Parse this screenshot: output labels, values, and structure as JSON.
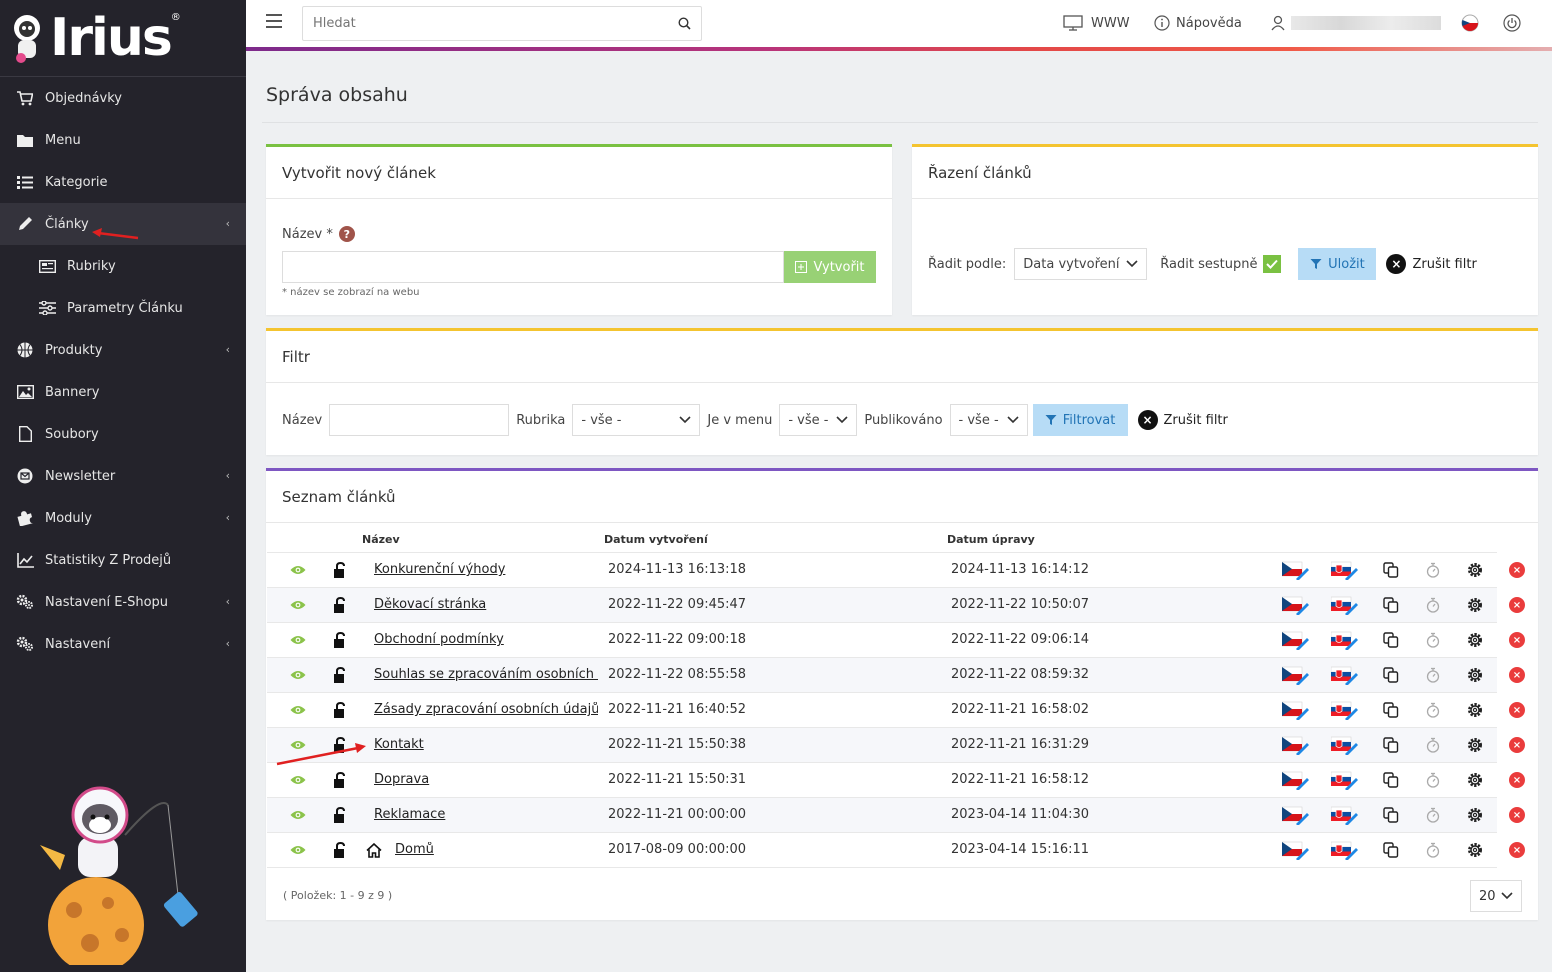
{
  "brand": {
    "logo_text": "Irius",
    "reg_mark": "®"
  },
  "sidebar": {
    "items": [
      {
        "label": "Objednávky",
        "icon": "cart-icon"
      },
      {
        "label": "Menu",
        "icon": "folder-icon"
      },
      {
        "label": "Kategorie",
        "icon": "list-icon"
      },
      {
        "label": "Články",
        "icon": "pencil-icon",
        "active": true
      },
      {
        "label": "Rubriky",
        "icon": "newspaper-icon",
        "sub": true
      },
      {
        "label": "Parametry Článku",
        "icon": "sliders-icon",
        "sub": true
      },
      {
        "label": "Produkty",
        "icon": "basketball-icon"
      },
      {
        "label": "Bannery",
        "icon": "image-icon"
      },
      {
        "label": "Soubory",
        "icon": "file-icon"
      },
      {
        "label": "Newsletter",
        "icon": "envelope-circle-icon"
      },
      {
        "label": "Moduly",
        "icon": "puzzle-icon"
      },
      {
        "label": "Statistiky Z Prodejů",
        "icon": "chart-line-icon"
      },
      {
        "label": "Nastavení E-Shopu",
        "icon": "gears-icon"
      },
      {
        "label": "Nastavení",
        "icon": "gears-icon"
      }
    ]
  },
  "topbar": {
    "search_placeholder": "Hledat",
    "www_label": "WWW",
    "help_label": "Nápověda"
  },
  "page": {
    "title": "Správa obsahu"
  },
  "create_card": {
    "title": "Vytvořit nový článek",
    "name_label": "Název *",
    "create_button": "Vytvořit",
    "hint": "* název se zobrazí na webu"
  },
  "sort_card": {
    "title": "Řazení článků",
    "sort_by_label": "Řadit podle:",
    "sort_by_value": "Data vytvoření",
    "desc_label": "Řadit sestupně",
    "save_button": "Uložit",
    "cancel_label": "Zrušit filtr"
  },
  "filter_card": {
    "title": "Filtr",
    "name_label": "Název",
    "rubrika_label": "Rubrika",
    "rubrika_value": "- vše -",
    "menu_label": "Je v menu",
    "menu_value": "- vše -",
    "published_label": "Publikováno",
    "published_value": "- vše -",
    "filter_button": "Filtrovat",
    "cancel_label": "Zrušit filtr"
  },
  "list_card": {
    "title": "Seznam článků",
    "columns": {
      "name": "Název",
      "created": "Datum vytvoření",
      "modified": "Datum úpravy"
    },
    "rows": [
      {
        "name": "Konkurenční výhody",
        "created": "2024-11-13 16:13:18",
        "modified": "2024-11-13 16:14:12"
      },
      {
        "name": "Děkovací stránka",
        "created": "2022-11-22 09:45:47",
        "modified": "2022-11-22 10:50:07"
      },
      {
        "name": "Obchodní podmínky",
        "created": "2022-11-22 09:00:18",
        "modified": "2022-11-22 09:06:14"
      },
      {
        "name": "Souhlas se zpracováním osobních údajů",
        "created": "2022-11-22 08:55:58",
        "modified": "2022-11-22 08:59:32"
      },
      {
        "name": "Zásady zpracování osobních údajů",
        "created": "2022-11-21 16:40:52",
        "modified": "2022-11-21 16:58:02"
      },
      {
        "name": "Kontakt",
        "created": "2022-11-21 15:50:38",
        "modified": "2022-11-21 16:31:29"
      },
      {
        "name": "Doprava",
        "created": "2022-11-21 15:50:31",
        "modified": "2022-11-21 16:58:12"
      },
      {
        "name": "Reklamace",
        "created": "2022-11-21 00:00:00",
        "modified": "2023-04-14 11:04:30"
      },
      {
        "name": "Domů",
        "created": "2017-08-09 00:00:00",
        "modified": "2023-04-14 15:16:11",
        "home": true
      }
    ],
    "pager_info": "( Položek: 1 - 9 z 9 )",
    "page_size": "20"
  },
  "colors": {
    "sidebar_bg": "#24232b",
    "accent_green": "#7ac142",
    "accent_yellow": "#f4c430",
    "accent_purple": "#7e57c2",
    "delete_red": "#ea3c3c",
    "annotation_red": "#e02020"
  }
}
